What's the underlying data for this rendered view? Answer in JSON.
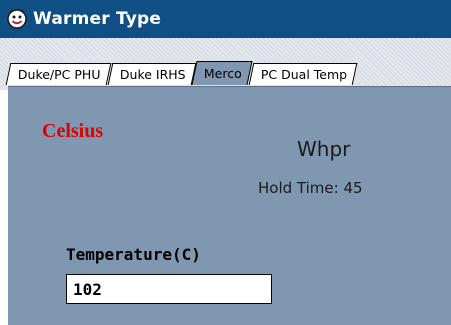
{
  "window": {
    "title": "Warmer Type",
    "icon": "smiley-app-icon"
  },
  "tabs": [
    {
      "label": "Duke/PC PHU",
      "active": false
    },
    {
      "label": "Duke IRHS",
      "active": false
    },
    {
      "label": "Merco",
      "active": true
    },
    {
      "label": "PC Dual Temp",
      "active": false
    }
  ],
  "panel": {
    "unit": "Celsius",
    "product": "Whpr",
    "hold_time": "Hold Time: 45",
    "temperature_label": "Temperature(C)",
    "temperature_value": "102"
  },
  "colors": {
    "titlebar": "#0f4f86",
    "panel": "#7f97b1",
    "unit_text": "#e00000"
  }
}
